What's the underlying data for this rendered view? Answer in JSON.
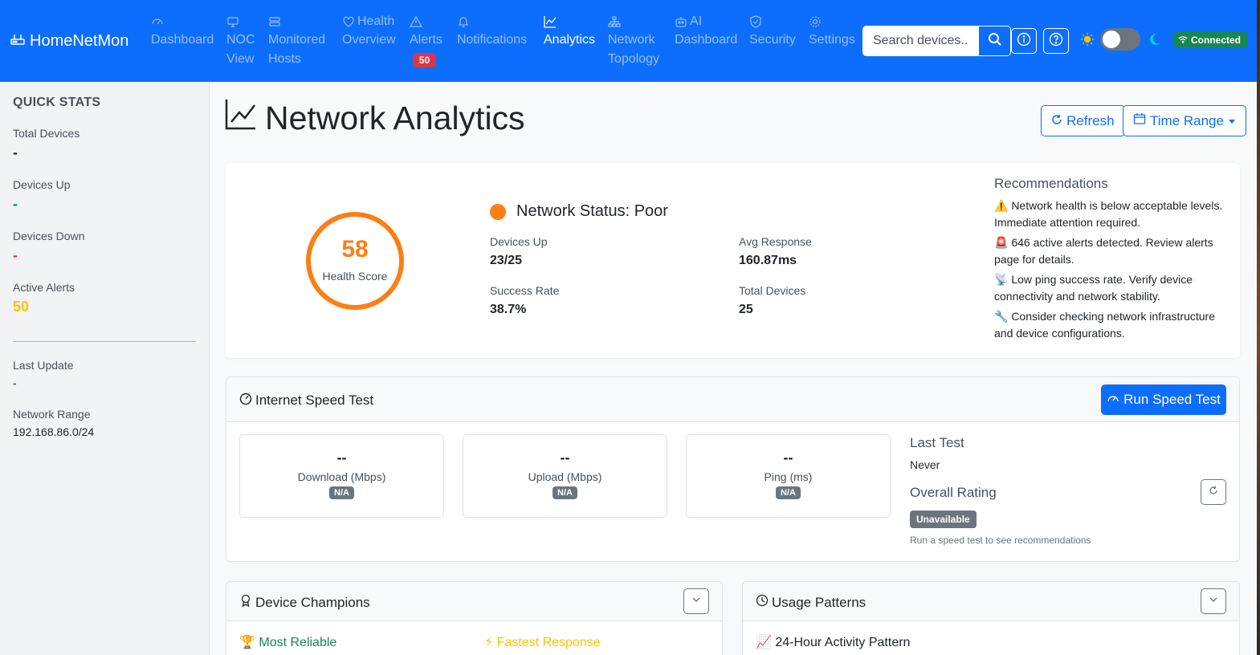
{
  "app": {
    "brand": "HomeNetMon"
  },
  "nav": {
    "items": [
      {
        "line1": "Dashboard",
        "line2": "",
        "icon": "speedometer-icon"
      },
      {
        "line1": "NOC",
        "line2": "View",
        "icon": "monitor-icon"
      },
      {
        "line1": "Monitored",
        "line2": "Hosts",
        "icon": "server-icon"
      },
      {
        "line1": "Health",
        "line2": "Overview",
        "icon": "heart-pulse-icon"
      },
      {
        "line1": "Alerts",
        "line2": "",
        "icon": "warning-icon"
      },
      {
        "line1": "Notifications",
        "line2": "",
        "icon": "bell-icon"
      },
      {
        "line1": "Analytics",
        "line2": "",
        "icon": "graph-icon"
      },
      {
        "line1": "Network",
        "line2": "Topology",
        "icon": "diagram-icon"
      },
      {
        "line1": "AI",
        "line2": "Dashboard",
        "icon": "robot-icon"
      },
      {
        "line1": "Security",
        "line2": "",
        "icon": "shield-icon"
      },
      {
        "line1": "Settings",
        "line2": "",
        "icon": "gear-icon"
      }
    ],
    "alerts_badge": "50",
    "search_placeholder": "Search devices...",
    "connection_status": "Connected"
  },
  "sidebar": {
    "title": "QUICK STATS",
    "total_devices_label": "Total Devices",
    "total_devices_value": "-",
    "devices_up_label": "Devices Up",
    "devices_up_value": "-",
    "devices_down_label": "Devices Down",
    "devices_down_value": "-",
    "active_alerts_label": "Active Alerts",
    "active_alerts_value": "50",
    "last_update_label": "Last Update",
    "last_update_value": "-",
    "network_range_label": "Network Range",
    "network_range_value": "192.168.86.0/24"
  },
  "page": {
    "title": "Network Analytics",
    "refresh_label": "Refresh",
    "time_range_label": "Time Range"
  },
  "health": {
    "score": "58",
    "score_label": "Health Score",
    "status": "Network Status: Poor",
    "devices_up_label": "Devices Up",
    "devices_up_value": "23/25",
    "avg_response_label": "Avg Response",
    "avg_response_value": "160.87ms",
    "success_rate_label": "Success Rate",
    "success_rate_value": "38.7%",
    "total_devices_label": "Total Devices",
    "total_devices_value": "25",
    "recommendations_title": "Recommendations",
    "recommendations": [
      "⚠️ Network health is below acceptable levels. Immediate attention required.",
      "🚨 646 active alerts detected. Review alerts page for details.",
      "📡 Low ping success rate. Verify device connectivity and network stability.",
      "🔧 Consider checking network infrastructure and device configurations."
    ],
    "colors": {
      "status": "#fd7e14"
    }
  },
  "speed_test": {
    "title": "Internet Speed Test",
    "run_button": "Run Speed Test",
    "download_value": "--",
    "download_label": "Download (Mbps)",
    "download_badge": "N/A",
    "upload_value": "--",
    "upload_label": "Upload (Mbps)",
    "upload_badge": "N/A",
    "ping_value": "--",
    "ping_label": "Ping (ms)",
    "ping_badge": "N/A",
    "last_test_label": "Last Test",
    "last_test_value": "Never",
    "overall_rating_label": "Overall Rating",
    "overall_rating_value": "Unavailable",
    "hint": "Run a speed test to see recommendations"
  },
  "champions": {
    "title": "Device Champions",
    "most_reliable": "🏆 Most Reliable",
    "fastest_response": "⚡ Fastest Response"
  },
  "usage": {
    "title": "Usage Patterns",
    "activity": "📈 24-Hour Activity Pattern"
  }
}
